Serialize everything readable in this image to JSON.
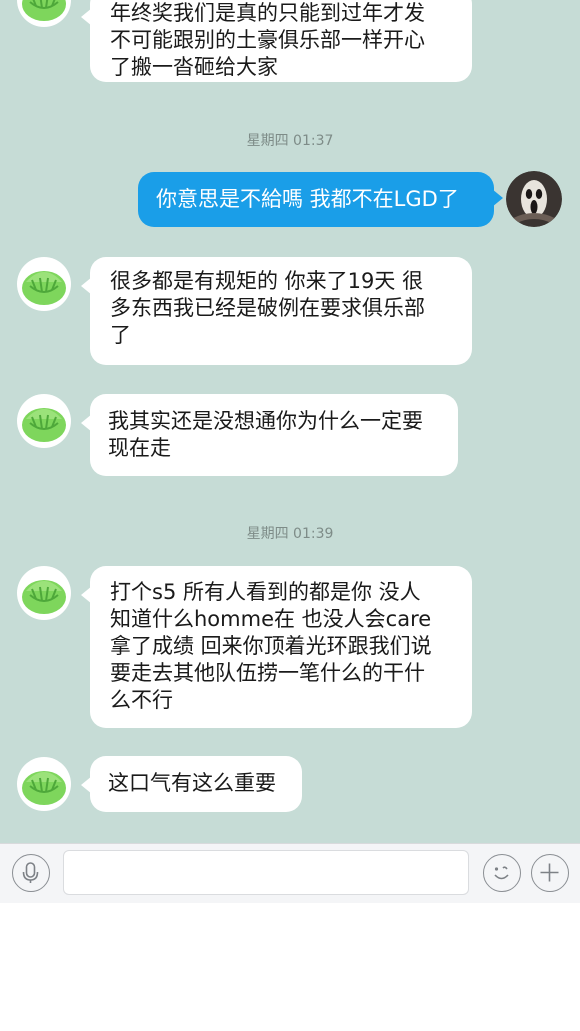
{
  "messages": [
    {
      "side": "in",
      "text": "年终奖我们是真的只能到过年才发\n不可能跟别的土豪俱乐部一样开心\n了搬一沓砸给大家"
    },
    {
      "timestamp": "星期四 01:37"
    },
    {
      "side": "out",
      "text": "你意思是不給嗎 我都不在LGD了"
    },
    {
      "side": "in",
      "text": "很多都是有规矩的 你来了19天 很\n多东西我已经是破例在要求俱乐部\n了"
    },
    {
      "side": "in",
      "text": "我其实还是没想通你为什么一定要\n现在走"
    },
    {
      "timestamp": "星期四 01:39"
    },
    {
      "side": "in",
      "text": "打个s5 所有人看到的都是你 没人\n知道什么homme在 也没人会care\n拿了成绩 回来你顶着光环跟我们说\n要走去其他队伍捞一笔什么的干什\n么不行"
    },
    {
      "side": "in",
      "text": "这口气有这么重要"
    }
  ],
  "input_bar": {
    "left_icon": "microphone-icon",
    "emoji_icon": "smiley-icon",
    "add_icon": "plus-icon",
    "input_value": ""
  },
  "colors": {
    "chat_background": "#c6dcd6",
    "incoming_bubble": "#ffffff",
    "outgoing_bubble": "#1a9ee8",
    "timestamp_text": "#7e8c88"
  }
}
